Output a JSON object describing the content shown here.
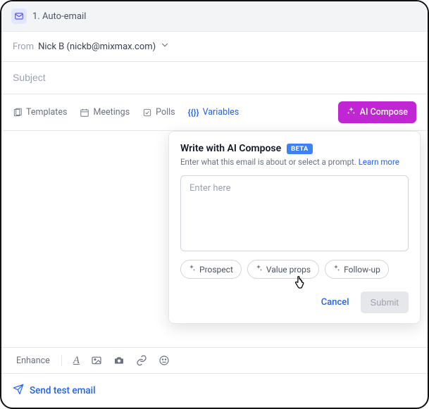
{
  "header": {
    "title": "1. Auto-email"
  },
  "from": {
    "label": "From",
    "value": "Nick B (nickb@mixmax.com)"
  },
  "subject": {
    "placeholder": "Subject"
  },
  "toolbar": {
    "templates": "Templates",
    "meetings": "Meetings",
    "polls": "Polls",
    "variables": "Variables",
    "ai_compose": "AI Compose"
  },
  "popover": {
    "title": "Write with AI Compose",
    "badge": "BETA",
    "subtitle_prefix": "Enter what this email is about or select a prompt. ",
    "learn_more": "Learn more",
    "textarea_placeholder": "Enter here",
    "chips": {
      "prospect": "Prospect",
      "value_props": "Value props",
      "follow_up": "Follow-up"
    },
    "cancel": "Cancel",
    "submit": "Submit"
  },
  "bottom": {
    "enhance": "Enhance"
  },
  "send": {
    "label": "Send test email"
  }
}
